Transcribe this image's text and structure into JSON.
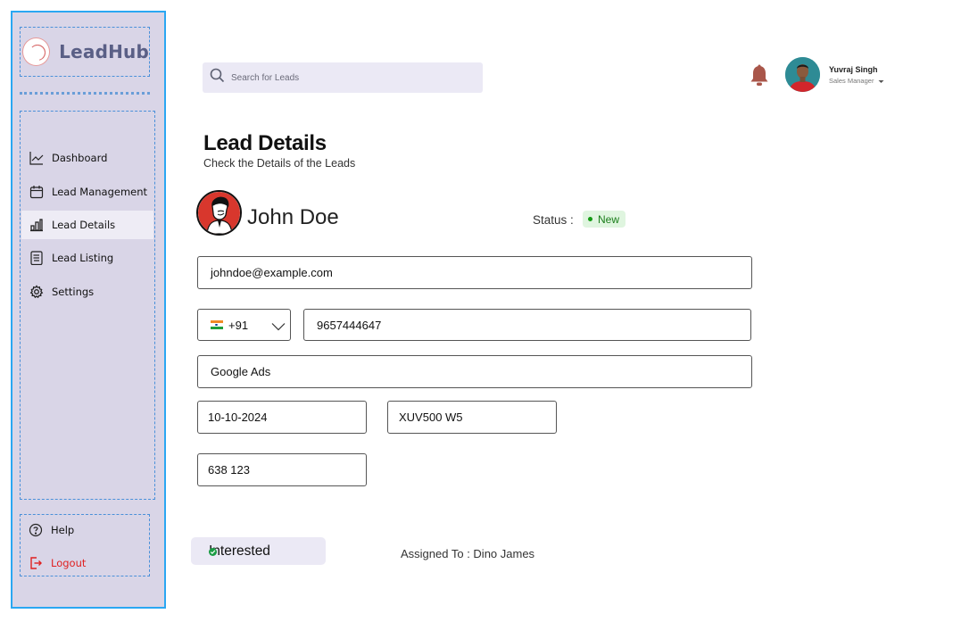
{
  "app": {
    "brand_name": "LeadHub",
    "brand_colors": {
      "accent": "#5a5f86",
      "sidebar_bg": "#d9d5e7",
      "outline": "#2aa7f2"
    }
  },
  "sidebar": {
    "items": [
      {
        "label": "Dashboard",
        "icon": "line-chart-icon",
        "active": false
      },
      {
        "label": "Lead Management",
        "icon": "calendar-icon",
        "active": false
      },
      {
        "label": "Lead Details",
        "icon": "bar-chart-icon",
        "active": true
      },
      {
        "label": "Lead Listing",
        "icon": "checklist-icon",
        "active": false
      },
      {
        "label": "Settings",
        "icon": "gear-icon",
        "active": false
      }
    ],
    "help_label": "Help",
    "logout_label": "Logout"
  },
  "header": {
    "search": {
      "placeholder": "Search for Leads"
    },
    "user": {
      "name": "Yuvraj Singh",
      "role": "Sales Manager"
    }
  },
  "page": {
    "title": "Lead Details",
    "subtitle": "Check the Details of the Leads"
  },
  "lead": {
    "name": "John Doe",
    "status_label": "Status :",
    "status": "New",
    "email": "johndoe@example.com",
    "country_code": "+91",
    "phone": "9657444647",
    "source": "Google Ads",
    "date": "10-10-2024",
    "vehicle": "XUV500 W5",
    "pincode": "638 123",
    "interest": "Interested",
    "assigned_to": "Assigned To : Dino James"
  }
}
